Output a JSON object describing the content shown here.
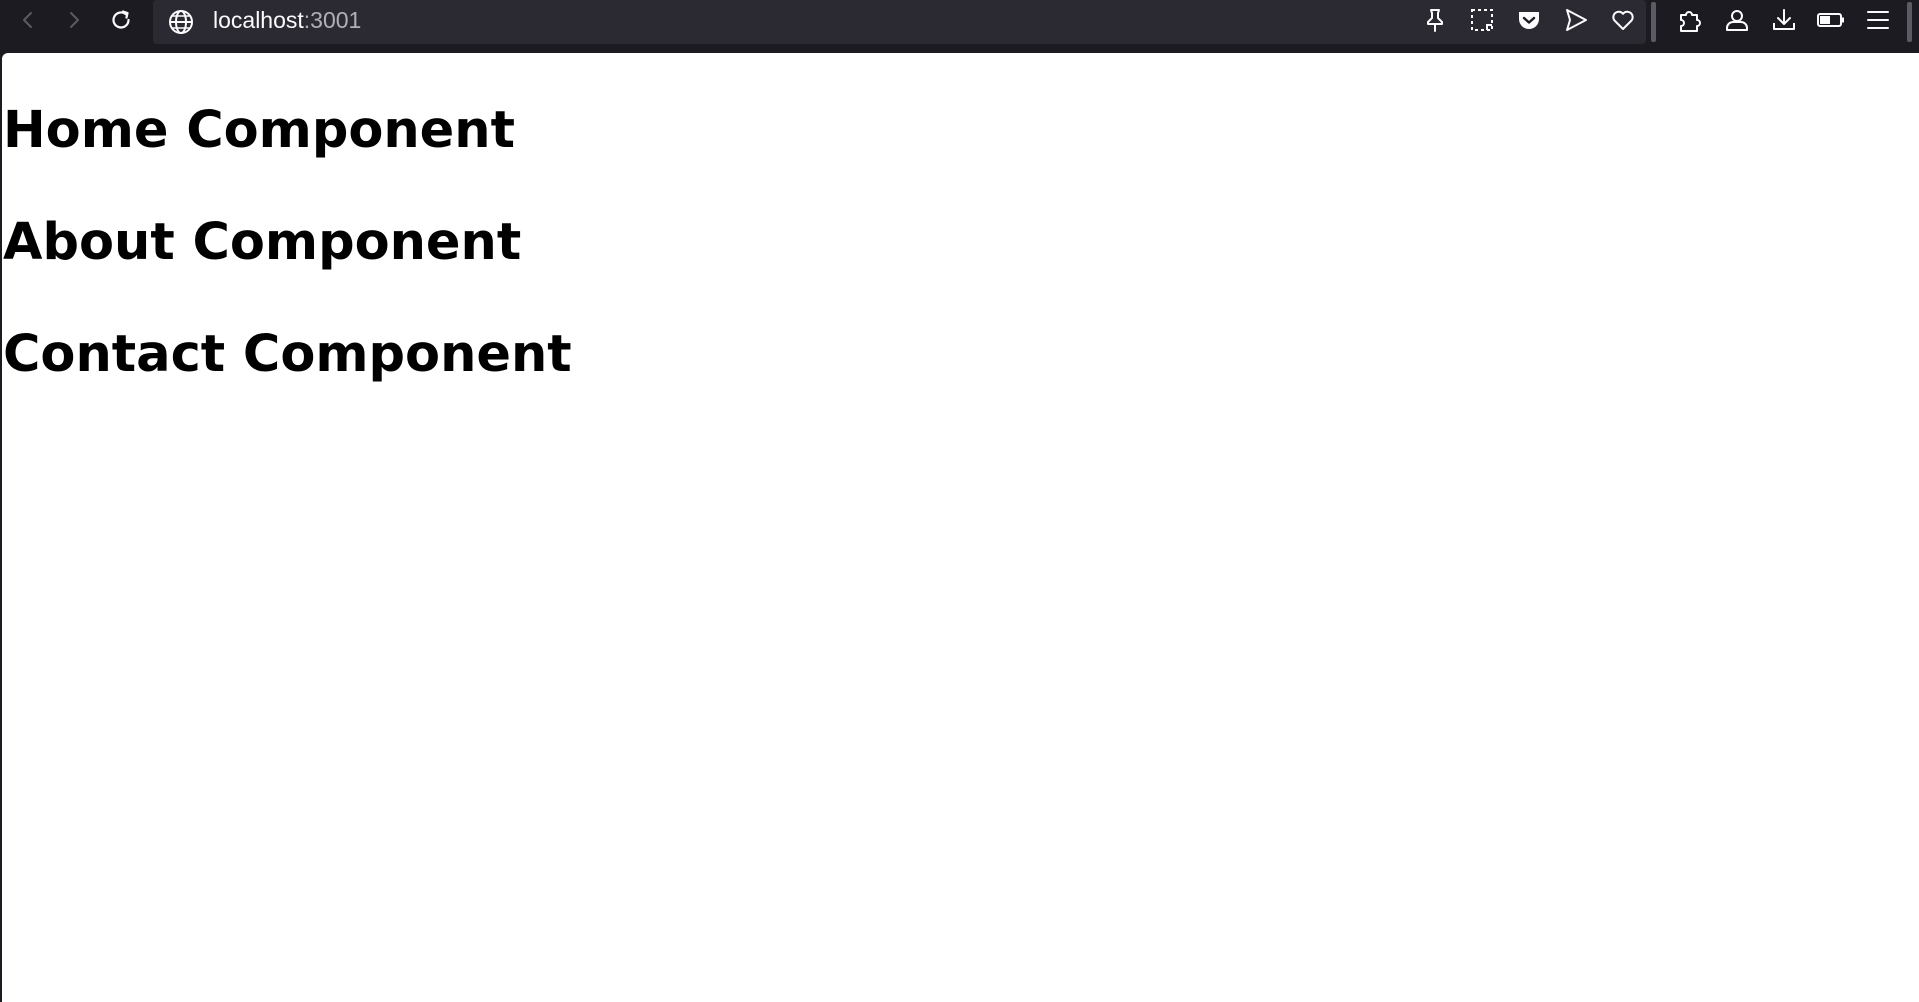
{
  "browser": {
    "url_host": "localhost",
    "url_port": ":3001",
    "icons": {
      "back": "back-arrow-icon",
      "forward": "forward-arrow-icon",
      "reload": "reload-icon",
      "site": "globe-icon",
      "pin": "pin-icon",
      "screenshot": "screenshot-icon",
      "pocket": "pocket-icon",
      "send": "send-icon",
      "favorite": "heart-icon",
      "extensions": "puzzle-icon",
      "account": "account-icon",
      "downloads": "download-icon",
      "battery": "battery-icon",
      "menu": "menu-icon"
    },
    "colors": {
      "toolbar_bg": "#1c1b22",
      "urlbar_bg": "#2b2a33",
      "text": "#fbfbfe",
      "muted_text": "#b0b0b6",
      "page_bg": "#ffffff"
    }
  },
  "page": {
    "headings": [
      "Home Component",
      "About Component",
      "Contact Component"
    ]
  }
}
